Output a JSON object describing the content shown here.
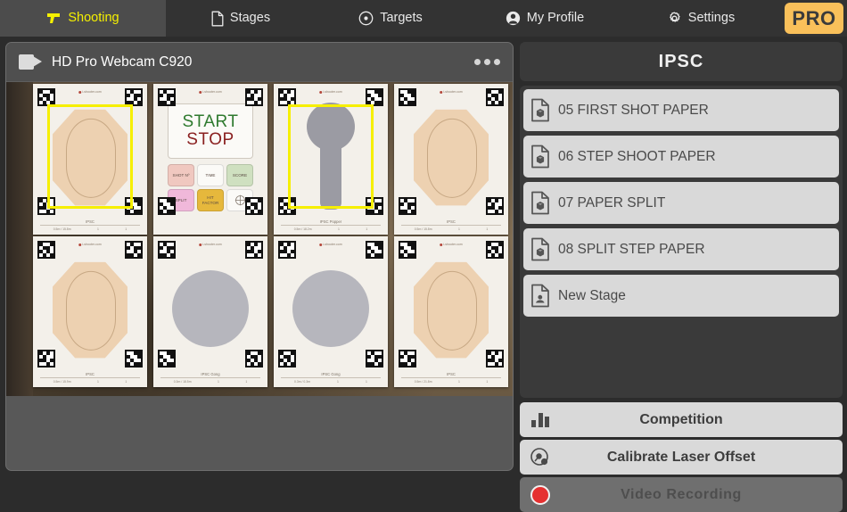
{
  "nav": {
    "tabs": [
      {
        "label": "Shooting",
        "icon": "pistol-icon",
        "active": true
      },
      {
        "label": "Stages",
        "icon": "document-icon",
        "active": false
      },
      {
        "label": "Targets",
        "icon": "target-reticle-icon",
        "active": false
      },
      {
        "label": "My Profile",
        "icon": "person-circle-icon",
        "active": false
      },
      {
        "label": "Settings",
        "icon": "gear-icon",
        "active": false
      }
    ],
    "pro_badge": "PRO",
    "accent_yellow": "#f5f000",
    "pro_bg": "#f9c05a"
  },
  "camera": {
    "title": "HD Pro Webcam C920",
    "icon": "video-camera-icon",
    "menu_icon": "more-options-icon"
  },
  "feed": {
    "selection_color": "#f6ef00",
    "targets": [
      {
        "type": "ipsc",
        "name": "IPSC",
        "dims": "0.5m / 15.8m",
        "val1": "1",
        "val2": "1",
        "selected": true
      },
      {
        "type": "control",
        "name": "",
        "dims": "",
        "val1": "",
        "val2": "",
        "selected": false
      },
      {
        "type": "popper",
        "name": "IPSC Popper",
        "dims": "0.5m / 18.2m",
        "val1": "1",
        "val2": "1",
        "selected": true
      },
      {
        "type": "ipsc",
        "name": "IPSC",
        "dims": "0.5m / 15.8m",
        "val1": "1",
        "val2": "1",
        "selected": false
      },
      {
        "type": "ipsc",
        "name": "IPSC",
        "dims": "0.5m / 15.9m",
        "val1": "1",
        "val2": "1",
        "selected": false
      },
      {
        "type": "gong",
        "name": "IPSC Gong",
        "dims": "0.3m / 18.5m",
        "val1": "1",
        "val2": "1",
        "selected": false
      },
      {
        "type": "gong",
        "name": "IPSC Gong",
        "dims": "0.3m / 0.3m",
        "val1": "1",
        "val2": "1",
        "selected": false
      },
      {
        "type": "ipsc",
        "name": "IPSC",
        "dims": "0.5m / 21.8m",
        "val1": "1",
        "val2": "1",
        "selected": false
      }
    ],
    "control_card": {
      "start": "START",
      "stop": "STOP",
      "start_color": "#2f7a2f",
      "stop_color": "#8a2020",
      "buttons": [
        {
          "label": "SHOT Nº",
          "color": "#f0c8c0"
        },
        {
          "label": "TIME",
          "color": "#fbfaf7"
        },
        {
          "label": "SCORE",
          "color": "#cfe0c0"
        },
        {
          "label": "SPLIT",
          "color": "#f0b8da"
        },
        {
          "label": "HIT FACTOR",
          "color": "#e6b83c"
        },
        {
          "label": "",
          "color": "#fbfaf7"
        }
      ]
    }
  },
  "sidebar": {
    "title": "IPSC",
    "stages": [
      {
        "label": "05 FIRST SHOT PAPER",
        "icon": "stage-cube-document-icon"
      },
      {
        "label": "06 STEP SHOOT PAPER",
        "icon": "stage-cube-document-icon"
      },
      {
        "label": "07 PAPER SPLIT",
        "icon": "stage-cube-document-icon"
      },
      {
        "label": "08 SPLIT STEP PAPER",
        "icon": "stage-cube-document-icon"
      },
      {
        "label": "New Stage",
        "icon": "new-stage-person-document-icon"
      }
    ],
    "actions": [
      {
        "label": "Competition",
        "icon": "bar-chart-icon",
        "disabled": false
      },
      {
        "label": "Calibrate Laser Offset",
        "icon": "laser-offset-icon",
        "disabled": false
      },
      {
        "label": "Video Recording",
        "icon": "record-dot-icon",
        "disabled": true
      }
    ]
  }
}
